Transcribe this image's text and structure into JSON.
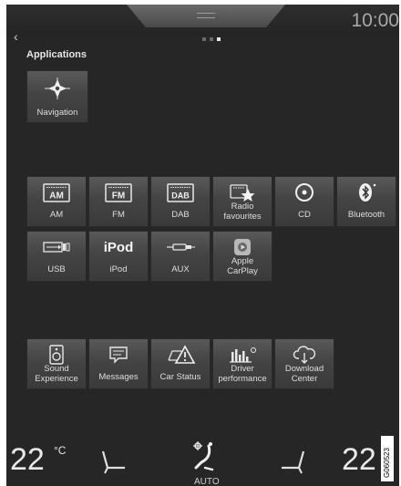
{
  "status_bar": {
    "clock": "10:00"
  },
  "page": {
    "section_title": "Applications",
    "pager": {
      "count": 3,
      "active": 3
    }
  },
  "apps": [
    {
      "label": "Navigation",
      "icon": "navigation-compass-icon"
    }
  ],
  "media": [
    {
      "label": "AM",
      "badge": "AM",
      "icon": "radio-am-icon"
    },
    {
      "label": "FM",
      "badge": "FM",
      "icon": "radio-fm-icon"
    },
    {
      "label": "DAB",
      "badge": "DAB",
      "icon": "radio-dab-icon"
    },
    {
      "label": "Radio favourites",
      "line1": "Radio",
      "line2": "favourites",
      "icon": "radio-favourites-icon"
    },
    {
      "label": "CD",
      "icon": "cd-icon"
    },
    {
      "label": "Bluetooth",
      "icon": "bluetooth-icon"
    },
    {
      "label": "USB",
      "icon": "usb-icon"
    },
    {
      "label": "iPod",
      "badge": "iPod",
      "icon": "ipod-icon"
    },
    {
      "label": "AUX",
      "icon": "aux-icon"
    },
    {
      "label": "Apple CarPlay",
      "line1": "Apple",
      "line2": "CarPlay",
      "icon": "carplay-icon"
    }
  ],
  "settings": [
    {
      "label": "Sound Experience",
      "line1": "Sound",
      "line2": "Experience",
      "icon": "speaker-icon"
    },
    {
      "label": "Messages",
      "icon": "messages-icon"
    },
    {
      "label": "Car Status",
      "icon": "car-status-warning-icon"
    },
    {
      "label": "Driver performance",
      "line1": "Driver",
      "line2": "performance",
      "icon": "driver-performance-icon"
    },
    {
      "label": "Download Center",
      "line1": "Download",
      "line2": "Center",
      "icon": "download-cloud-icon"
    }
  ],
  "climate": {
    "left_temp": "22",
    "left_unit": "°C",
    "right_temp": "22",
    "mode": "AUTO"
  },
  "image_id": "G060523",
  "colors": {
    "screen_bg": "#262626",
    "tile_top": "#595959",
    "tile_bottom": "#3a3a3a",
    "text": "#dedede"
  }
}
